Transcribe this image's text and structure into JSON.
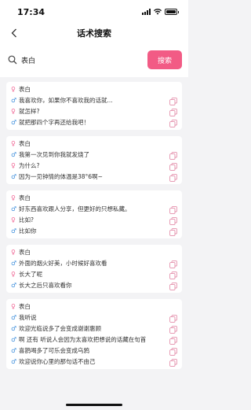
{
  "status_bar": {
    "time": "17:34"
  },
  "nav": {
    "title": "话术搜索"
  },
  "search": {
    "value": "表白",
    "button_label": "搜索"
  },
  "colors": {
    "accent": "#f25b85",
    "female": "#f06292",
    "male": "#3f8fdc",
    "copy": "#e48fab"
  },
  "cards": [
    {
      "lines": [
        {
          "gender": "female",
          "text": "表白",
          "copy": false
        },
        {
          "gender": "male",
          "text": "我喜欢你，如果你不喜欢我的话就...",
          "copy": true
        },
        {
          "gender": "female",
          "text": "就怎样?",
          "copy": true
        },
        {
          "gender": "male",
          "text": "就把那四个字再还给我吧！",
          "copy": true
        }
      ]
    },
    {
      "lines": [
        {
          "gender": "female",
          "text": "表白",
          "copy": false
        },
        {
          "gender": "male",
          "text": "我第一次见到你我就发烧了",
          "copy": true
        },
        {
          "gender": "female",
          "text": "为什么?",
          "copy": true
        },
        {
          "gender": "male",
          "text": "因为一见钟情的体温是38°6啊~",
          "copy": true
        }
      ]
    },
    {
      "lines": [
        {
          "gender": "female",
          "text": "表白",
          "copy": false
        },
        {
          "gender": "male",
          "text": "好东西喜欢跟人分享，但更好的只想私藏。",
          "copy": true
        },
        {
          "gender": "female",
          "text": "比如?",
          "copy": true
        },
        {
          "gender": "male",
          "text": "比如你",
          "copy": true
        }
      ]
    },
    {
      "lines": [
        {
          "gender": "female",
          "text": "表白",
          "copy": false
        },
        {
          "gender": "male",
          "text": "外面的烟火好美，小时候好喜欢看",
          "copy": true
        },
        {
          "gender": "female",
          "text": "长大了呢",
          "copy": true
        },
        {
          "gender": "male",
          "text": "长大之后只喜欢看你",
          "copy": true
        }
      ]
    },
    {
      "lines": [
        {
          "gender": "female",
          "text": "表白",
          "copy": false
        },
        {
          "gender": "male",
          "text": "我听说",
          "copy": true
        },
        {
          "gender": "male",
          "text": "欢迎光临说多了会变成谢谢惠顾",
          "copy": true
        },
        {
          "gender": "male",
          "text": "啊 还有 听说人会因为太喜欢把想说的话藏在句首",
          "copy": true
        },
        {
          "gender": "male",
          "text": "喜鹊喝多了可乐会变成乌鸦",
          "copy": true
        },
        {
          "gender": "male",
          "text": "欢迎说你心里的那句话不由己",
          "copy": true
        }
      ]
    }
  ]
}
